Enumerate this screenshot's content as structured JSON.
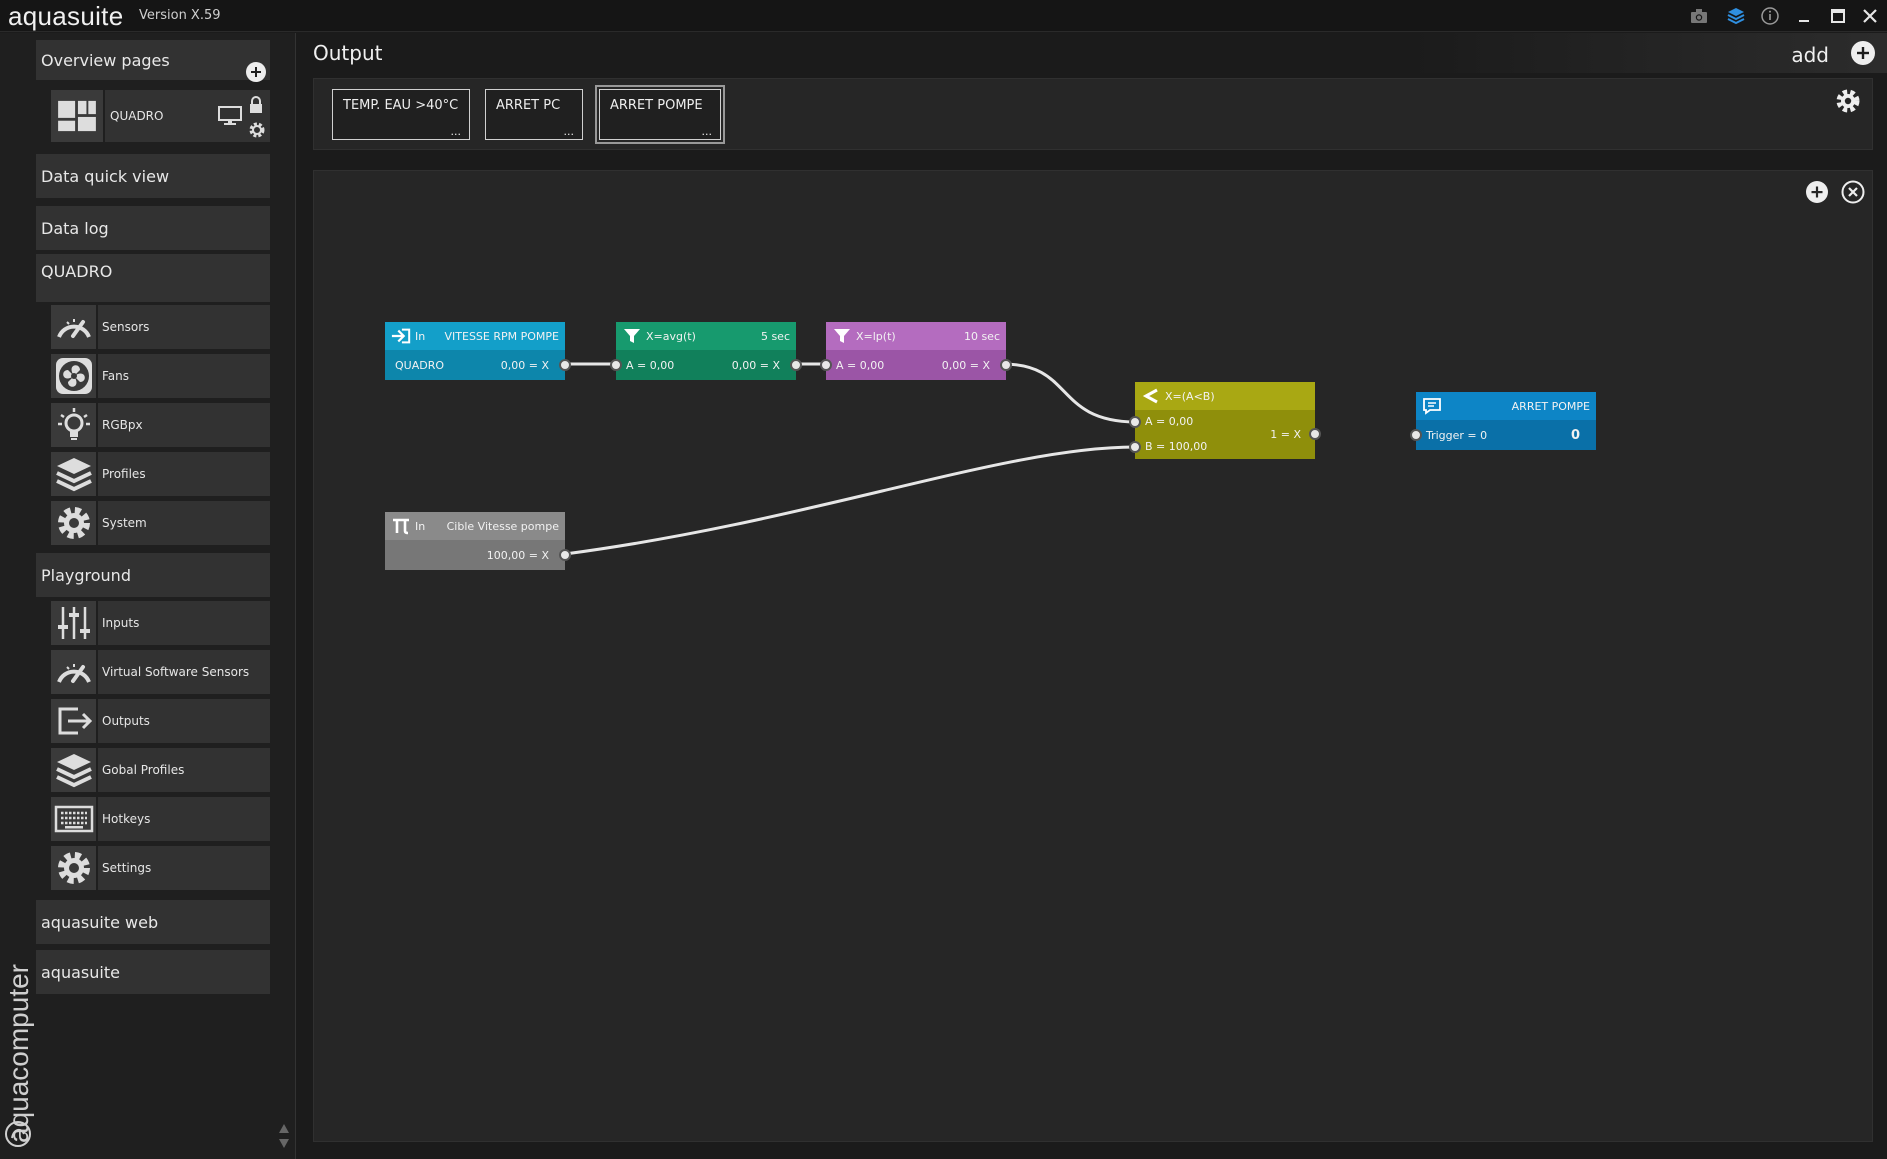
{
  "app": {
    "title": "aquasuite",
    "version": "Version X.59",
    "brand_vertical": "aquacomputer"
  },
  "sidebar": {
    "overview_pages": "Overview pages",
    "quadro_page": "QUADRO",
    "data_quick_view": "Data quick view",
    "data_log": "Data log",
    "quadro_section": "QUADRO",
    "quadro_items": [
      {
        "label": "Sensors",
        "icon": "gauge-icon"
      },
      {
        "label": "Fans",
        "icon": "fan-icon"
      },
      {
        "label": "RGBpx",
        "icon": "lightbulb-icon"
      },
      {
        "label": "Profiles",
        "icon": "layers-icon"
      },
      {
        "label": "System",
        "icon": "gear-icon"
      }
    ],
    "playground": "Playground",
    "playground_items": [
      {
        "label": "Inputs",
        "icon": "sliders-icon"
      },
      {
        "label": "Virtual Software Sensors",
        "icon": "gauge-icon"
      },
      {
        "label": "Outputs",
        "icon": "output-icon"
      },
      {
        "label": "Gobal Profiles",
        "icon": "layers-icon"
      },
      {
        "label": "Hotkeys",
        "icon": "keyboard-icon"
      },
      {
        "label": "Settings",
        "icon": "gear-icon"
      }
    ],
    "aquasuite_web": "aquasuite web",
    "aquasuite": "aquasuite"
  },
  "main": {
    "title": "Output",
    "add_label": "add",
    "tabs": [
      {
        "label": "TEMP. EAU >40°C",
        "more": "..."
      },
      {
        "label": "ARRET PC",
        "more": "..."
      },
      {
        "label": "ARRET POMPE",
        "more": "..."
      }
    ]
  },
  "nodes": {
    "input_rpm": {
      "kind": "In",
      "name": "VITESSE RPM POMPE",
      "source": "QUADRO",
      "value": "0,00 = X"
    },
    "avg": {
      "formula": "X=avg(t)",
      "param": "5 sec",
      "input": "A = 0,00",
      "output": "0,00 = X"
    },
    "lp": {
      "formula": "X=lp(t)",
      "param": "10 sec",
      "input": "A = 0,00",
      "output": "0,00 = X"
    },
    "compare": {
      "formula": "X=(A<B)",
      "a": "A = 0,00",
      "b": "B =  100,00",
      "output": "1 = X"
    },
    "output": {
      "name": "ARRET POMPE",
      "trigger": "Trigger =  0",
      "value": "0"
    },
    "constant": {
      "kind": "In",
      "name": "Cible Vitesse pompe",
      "value": "100,00 = X"
    }
  },
  "colors": {
    "input_node": "#139fc9",
    "input_node_dark": "#0d86ab",
    "avg_node": "#179a6e",
    "avg_node_dark": "#11805b",
    "lp_node": "#b46cbf",
    "lp_node_dark": "#9b55a6",
    "compare_node": "#a9a813",
    "compare_node_dark": "#8f8f0b",
    "output_node": "#0d85c6",
    "output_node_dark": "#0a70a8",
    "constant_node": "#8a8a8a",
    "constant_node_dark": "#777777"
  }
}
